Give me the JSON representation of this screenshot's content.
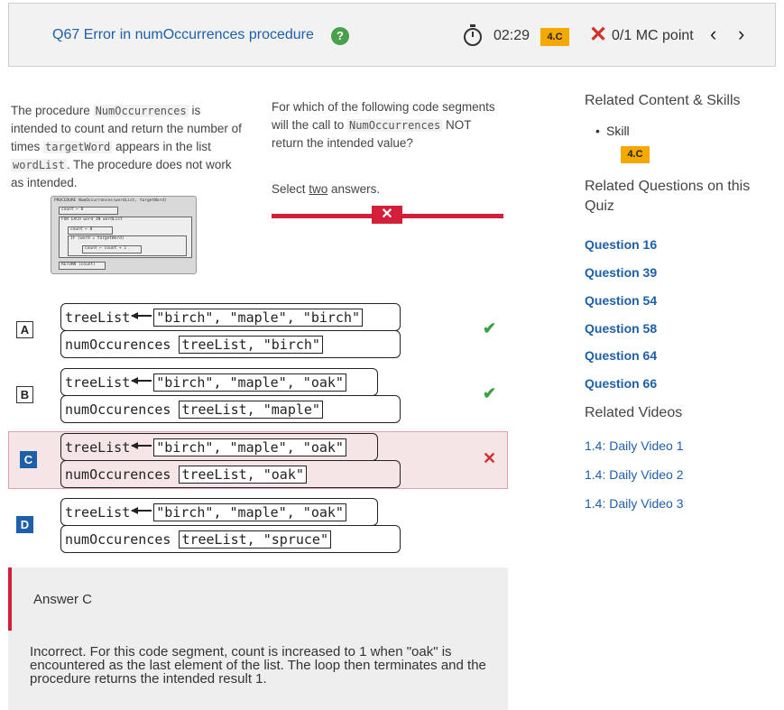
{
  "header": {
    "title": "Q67 Error in numOccurrences procedure",
    "help_glyph": "?",
    "timer": "02:29",
    "skill_badge": "4.C",
    "points": "0/1 MC point",
    "prev_glyph": "‹",
    "next_glyph": "›"
  },
  "prompt": {
    "t1": "The procedure ",
    "c1": "NumOccurrences",
    "t2": " is intended to count and return the number of times ",
    "c2": "targetWord",
    "t3": " appears in the list ",
    "c3": "wordList",
    "t4": ". The procedure does not work as intended.",
    "diagram_lines": [
      "PROCEDURE NumOccurrences(wordList, targetWord)",
      "count ← 0",
      "FOR EACH word IN wordList",
      "count ← 0",
      "IF (word = targetWord)",
      "count ← count + 1",
      "RETURN (count)"
    ]
  },
  "question": {
    "t1": "For which of the following code segments will the call to ",
    "c1": "NumOccurrences",
    "t2": " NOT return the intended value?",
    "select_prefix": "Select ",
    "select_underlined": "two",
    "select_suffix": " answers.",
    "eliminate_glyph": "✕"
  },
  "options": [
    {
      "letter": "A",
      "line1_var": "treeList",
      "line1_list": "\"birch\", \"maple\", \"birch\"",
      "line2_proc": "numOccurences",
      "line2_args": "treeList, \"birch\"",
      "mark": "✔"
    },
    {
      "letter": "B",
      "line1_var": "treeList",
      "line1_list": "\"birch\", \"maple\", \"oak\"",
      "line2_proc": "numOccurences",
      "line2_args": "treeList, \"maple\"",
      "mark": "✔"
    },
    {
      "letter": "C",
      "line1_var": "treeList",
      "line1_list": "\"birch\", \"maple\", \"oak\"",
      "line2_proc": "numOccurences",
      "line2_args": "treeList, \"oak\"",
      "mark": "✕"
    },
    {
      "letter": "D",
      "line1_var": "treeList",
      "line1_list": "\"birch\", \"maple\", \"oak\"",
      "line2_proc": "numOccurences",
      "line2_args": "treeList, \"spruce\""
    }
  ],
  "answer": {
    "title": "Answer C",
    "explanation": "Incorrect. For this code segment,  count  is increased to  1  when  \"oak\"  is encountered as the last element of the list. The loop then terminates and the procedure returns the intended result  1."
  },
  "sidebar": {
    "related_content_heading": "Related Content & Skills",
    "skill_label": "Skill",
    "skill_badge": "4.C",
    "related_questions_heading": "Related Questions on this Quiz",
    "questions": [
      "Question 16",
      "Question 39",
      "Question 54",
      "Question 58",
      "Question 64",
      "Question 66"
    ],
    "related_videos_heading": "Related Videos",
    "videos": [
      "1.4: Daily Video 1",
      "1.4: Daily Video 2",
      "1.4: Daily Video 3"
    ]
  },
  "colors": {
    "accent_blue": "#1d5fa8",
    "error_red": "#d41f3a",
    "correct_green": "#3ba245",
    "badge_orange": "#f5a800"
  }
}
